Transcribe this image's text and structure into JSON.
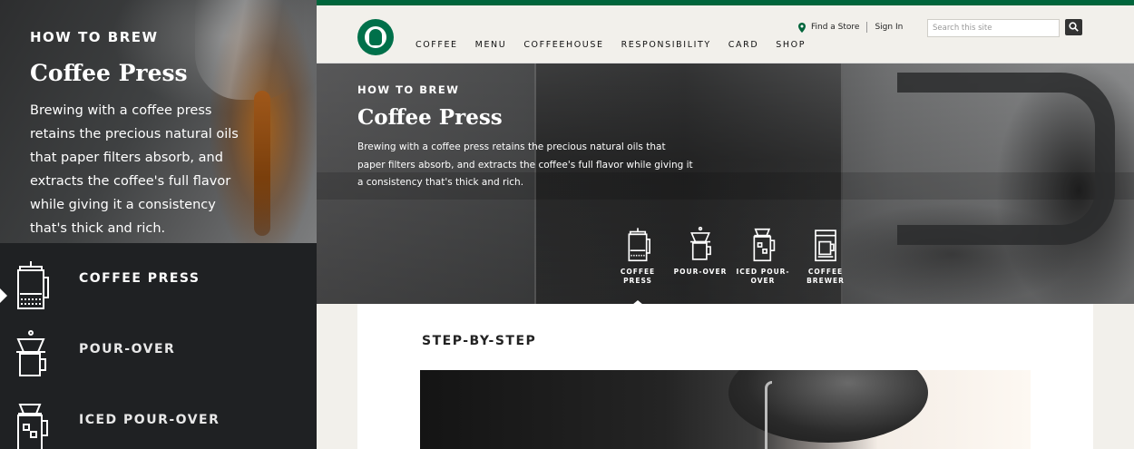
{
  "left_panel": {
    "kicker": "HOW TO BREW",
    "title": "Coffee Press",
    "description": "Brewing with a coffee press retains the precious natural oils that paper filters absorb, and extracts the coffee's full flavor while giving it a consistency that's thick and rich.",
    "menu": [
      {
        "label": "COFFEE PRESS",
        "icon": "coffee-press-icon",
        "active": true
      },
      {
        "label": "POUR-OVER",
        "icon": "pour-over-icon",
        "active": false
      },
      {
        "label": "ICED POUR-OVER",
        "icon": "iced-pour-over-icon",
        "active": false
      }
    ]
  },
  "header": {
    "logo": "starbucks-logo",
    "nav": [
      "COFFEE",
      "MENU",
      "COFFEEHOUSE",
      "RESPONSIBILITY",
      "CARD",
      "SHOP"
    ],
    "find_store": "Find a Store",
    "sign_in": "Sign In",
    "search_placeholder": "Search this site"
  },
  "hero": {
    "kicker": "HOW TO BREW",
    "title": "Coffee Press",
    "description": "Brewing with a coffee press retains the precious natural oils that paper filters absorb, and extracts the coffee's full flavor while giving it a consistency that's thick and rich.",
    "methods": [
      {
        "label_line1": "COFFEE",
        "label_line2": "PRESS",
        "icon": "coffee-press-icon",
        "active": true
      },
      {
        "label_line1": "POUR-OVER",
        "label_line2": "",
        "icon": "pour-over-icon",
        "active": false
      },
      {
        "label_line1": "ICED POUR-",
        "label_line2": "OVER",
        "icon": "iced-pour-over-icon",
        "active": false
      },
      {
        "label_line1": "COFFEE",
        "label_line2": "BREWER",
        "icon": "coffee-brewer-icon",
        "active": false
      }
    ]
  },
  "content": {
    "section_title": "STEP-BY-STEP"
  },
  "colors": {
    "brand_green": "#00653b",
    "dark_panel": "#1f2123",
    "page_bg": "#f2f0eb"
  }
}
